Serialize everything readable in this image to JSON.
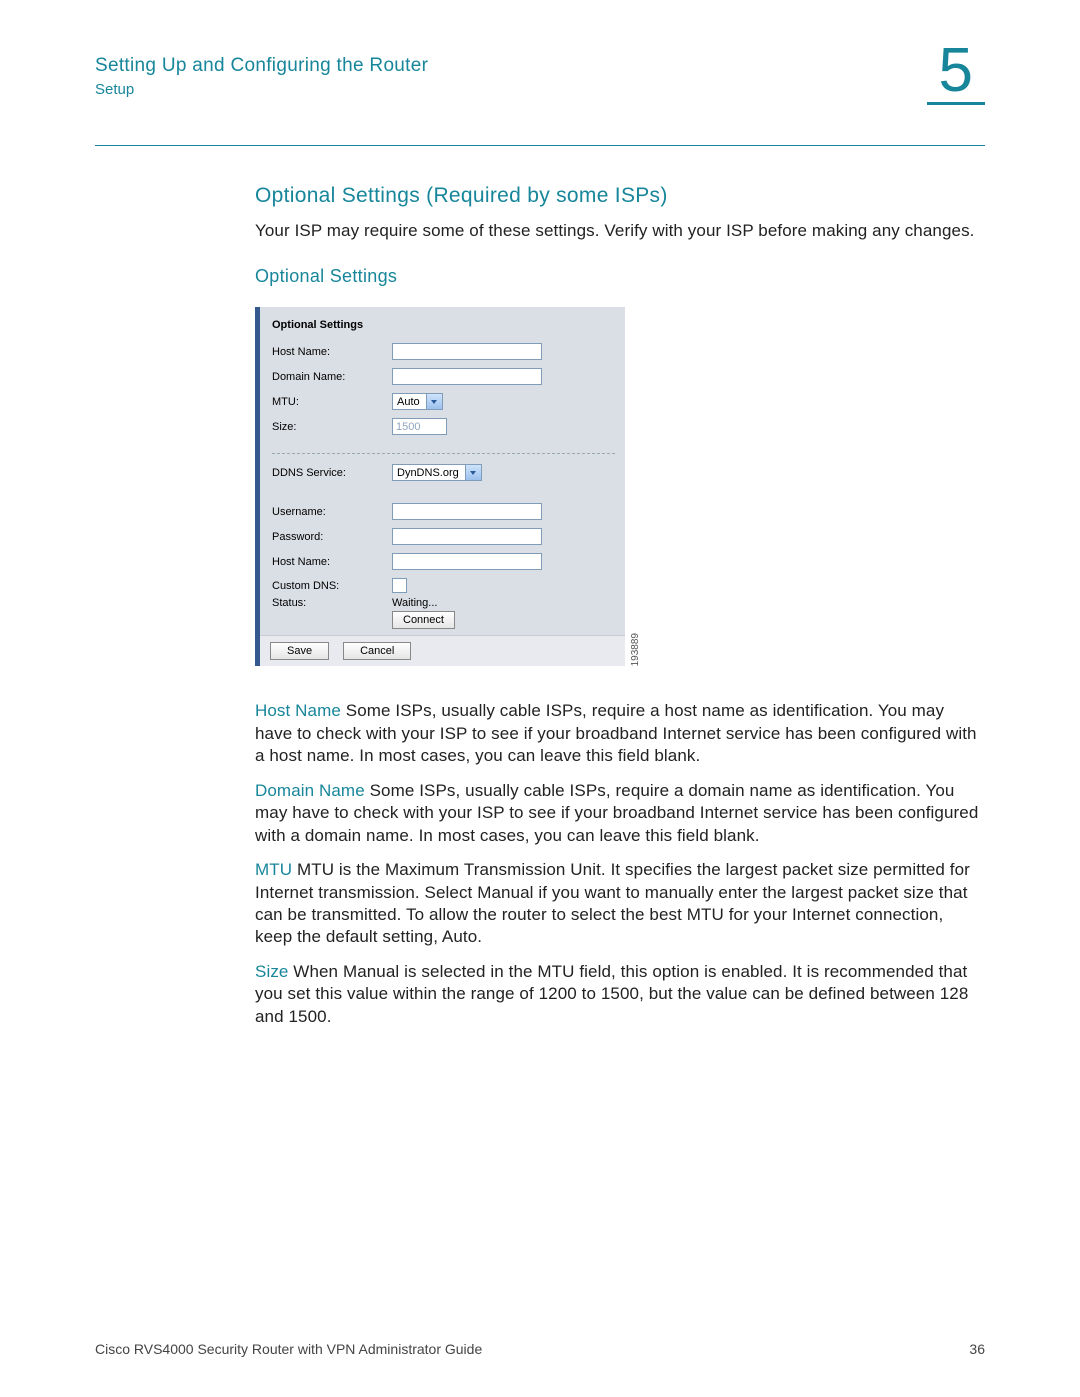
{
  "header": {
    "chapter_title": "Setting Up and Configuring the Router",
    "breadcrumb": "Setup",
    "chapter_number": "5"
  },
  "section": {
    "title": "Optional Settings (Required by some ISPs)",
    "intro": "Your ISP may require some of these settings. Verify with your ISP before making any changes.",
    "subheading": "Optional Settings"
  },
  "screenshot": {
    "panel_title": "Optional Settings",
    "fields": {
      "host_name_label": "Host Name:",
      "host_name_value": "",
      "domain_name_label": "Domain Name:",
      "domain_name_value": "",
      "mtu_label": "MTU:",
      "mtu_select": "Auto",
      "size_label": "Size:",
      "size_value": "1500",
      "ddns_label": "DDNS Service:",
      "ddns_select": "DynDNS.org",
      "username_label": "Username:",
      "username_value": "",
      "password_label": "Password:",
      "password_value": "",
      "host_name2_label": "Host Name:",
      "host_name2_value": "",
      "custom_dns_label": "Custom DNS:",
      "status_label": "Status:",
      "status_value": "Waiting...",
      "connect_btn": "Connect",
      "save_btn": "Save",
      "cancel_btn": "Cancel"
    },
    "image_code": "193889"
  },
  "defs": {
    "host_name": {
      "t": "Host Name",
      "b": " Some ISPs, usually cable ISPs, require a host name as identification. You may have to check with your ISP to see if your broadband Internet service has been configured with a host name. In most cases, you can leave this field blank."
    },
    "domain_name": {
      "t": "Domain Name",
      "b": " Some ISPs, usually cable ISPs, require a domain name as identification. You may have to check with your ISP to see if your broadband Internet service has been configured with a domain name. In most cases, you can leave this field blank."
    },
    "mtu": {
      "t": "MTU",
      "b": " MTU is the Maximum Transmission Unit. It specifies the largest packet size permitted for Internet transmission. Select Manual if you want to manually enter the largest packet size that can be transmitted. To allow the router to select the best MTU for your Internet connection, keep the default setting, Auto."
    },
    "size": {
      "t": "Size",
      "b": " When Manual is selected in the MTU field, this option is enabled. It is recommended that you set this value within the range of 1200 to 1500, but the value can be defined between 128 and 1500."
    }
  },
  "footer": {
    "doc_title": "Cisco RVS4000 Security Router with VPN Administrator Guide",
    "page_number": "36"
  }
}
